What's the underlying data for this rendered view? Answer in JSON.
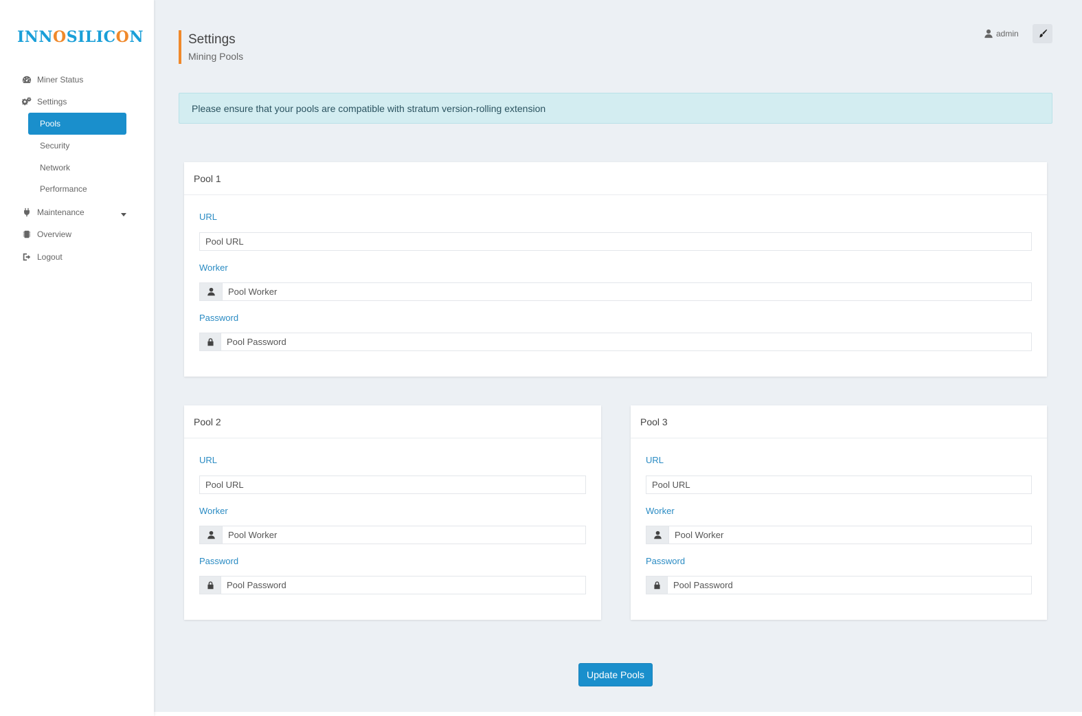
{
  "brand": {
    "logo_pre": "INN",
    "logo_o": "O",
    "logo_post": "SILIC",
    "logo_o2": "O",
    "logo_end": "N"
  },
  "sidebar": {
    "items": [
      {
        "label": "Miner Status",
        "icon": "dashboard-icon"
      },
      {
        "label": "Settings",
        "icon": "gears-icon"
      },
      {
        "label": "Maintenance",
        "icon": "plug-icon"
      },
      {
        "label": "Overview",
        "icon": "chip-icon"
      },
      {
        "label": "Logout",
        "icon": "sign-out-icon"
      }
    ],
    "settings_sub": [
      "Pools",
      "Security",
      "Network",
      "Performance"
    ],
    "active_sub": "Pools"
  },
  "header": {
    "title": "Settings",
    "subtitle": "Mining Pools",
    "user": "admin"
  },
  "alert": "Please ensure that your pools are compatible with stratum version-rolling extension",
  "pools": [
    {
      "title": "Pool 1",
      "url_label": "URL",
      "url_placeholder": "Pool URL",
      "worker_label": "Worker",
      "worker_placeholder": "Pool Worker",
      "password_label": "Password",
      "password_placeholder": "Pool Password"
    },
    {
      "title": "Pool 2",
      "url_label": "URL",
      "url_placeholder": "Pool URL",
      "worker_label": "Worker",
      "worker_placeholder": "Pool Worker",
      "password_label": "Password",
      "password_placeholder": "Pool Password"
    },
    {
      "title": "Pool 3",
      "url_label": "URL",
      "url_placeholder": "Pool URL",
      "worker_label": "Worker",
      "worker_placeholder": "Pool Worker",
      "password_label": "Password",
      "password_placeholder": "Pool Password"
    }
  ],
  "actions": {
    "update_label": "Update Pools"
  },
  "colors": {
    "accent": "#1a8fcc",
    "brand_orange": "#f0892b",
    "label_blue": "#2a8bc3",
    "alert_bg": "#d3edf1"
  }
}
